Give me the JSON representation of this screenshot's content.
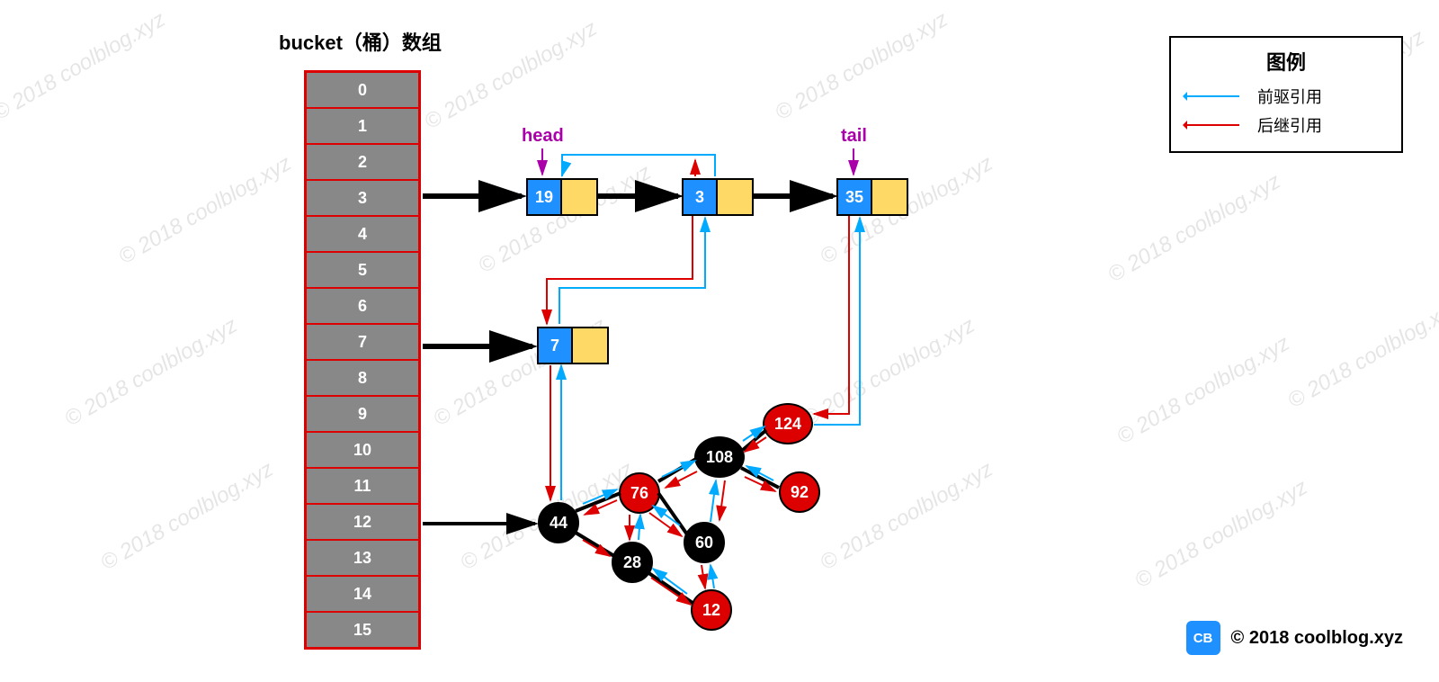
{
  "title": "bucket（桶）数组",
  "watermark": "© 2018 coolblog.xyz",
  "buckets": [
    "0",
    "1",
    "2",
    "3",
    "4",
    "5",
    "6",
    "7",
    "8",
    "9",
    "10",
    "11",
    "12",
    "13",
    "14",
    "15"
  ],
  "head_label": "head",
  "tail_label": "tail",
  "list_nodes": {
    "n19": "19",
    "n3": "3",
    "n35": "35",
    "n7": "7"
  },
  "tree_nodes": {
    "t44": {
      "val": "44",
      "color": "black"
    },
    "t76": {
      "val": "76",
      "color": "red"
    },
    "t28": {
      "val": "28",
      "color": "black"
    },
    "t12": {
      "val": "12",
      "color": "red"
    },
    "t60": {
      "val": "60",
      "color": "black"
    },
    "t108": {
      "val": "108",
      "color": "black"
    },
    "t124": {
      "val": "124",
      "color": "red"
    },
    "t92": {
      "val": "92",
      "color": "red"
    }
  },
  "legend": {
    "title": "图例",
    "prev": "前驱引用",
    "next": "后继引用"
  },
  "copyright": "© 2018 coolblog.xyz",
  "cb": "CB"
}
